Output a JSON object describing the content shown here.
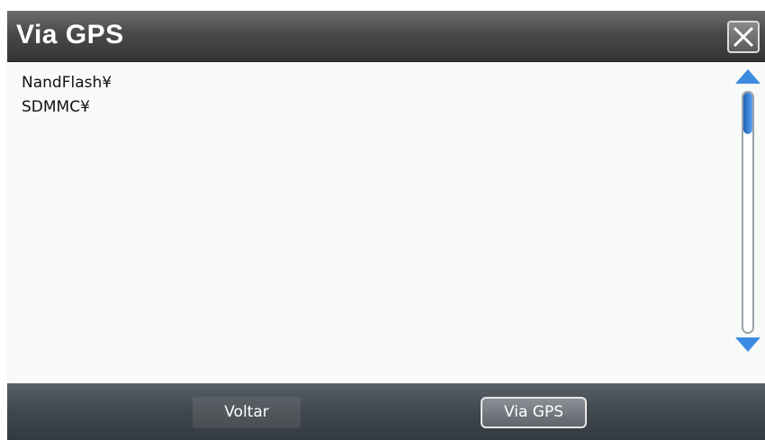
{
  "dialog": {
    "title": "Via GPS",
    "close_icon": "close-icon"
  },
  "file_list": {
    "items": [
      "NandFlash¥",
      "SDMMC¥"
    ]
  },
  "scrollbar": {
    "up_icon": "scroll-up-arrow-icon",
    "down_icon": "scroll-down-arrow-icon",
    "accent_color": "#3c8be0",
    "position": 0
  },
  "footer": {
    "back_label": "Voltar",
    "confirm_label": "Via GPS"
  }
}
